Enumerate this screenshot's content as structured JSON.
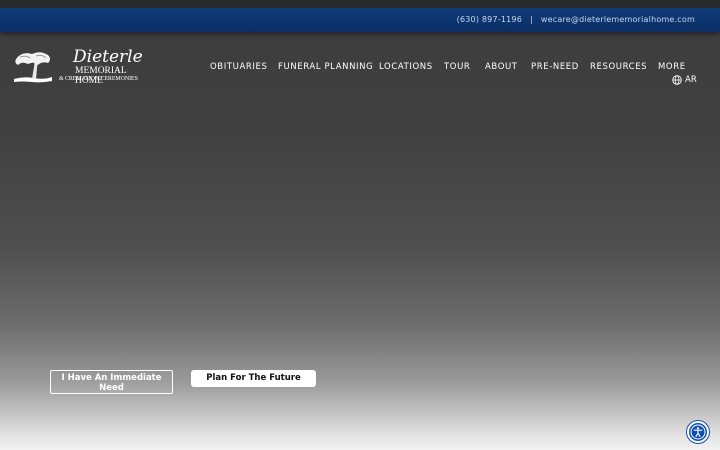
{
  "topbar": {
    "phone": "(630) 897-1196",
    "separator": "|",
    "email": "wecare@dieterlememorialhome.com"
  },
  "logo": {
    "name": "Dieterle",
    "line1": "MEMORIAL HOME",
    "line2": "& CREMATION CEREMONIES"
  },
  "nav": {
    "items": [
      {
        "label": "OBITUARIES"
      },
      {
        "label": "FUNERAL PLANNING"
      },
      {
        "label": "LOCATIONS"
      },
      {
        "label": "TOUR"
      },
      {
        "label": "ABOUT"
      },
      {
        "label": "PRE-NEED"
      },
      {
        "label": "RESOURCES"
      },
      {
        "label": "MORE"
      }
    ],
    "language": "AR"
  },
  "hero": {
    "immediate_need_label": "I Have An Immediate Need",
    "plan_future_label": "Plan For The Future"
  },
  "colors": {
    "topbar_blue": "#0b2f66",
    "accessibility_blue": "#0f4fb0"
  },
  "icons": [
    "globe-icon",
    "accessibility-icon",
    "tree-logo-icon"
  ]
}
